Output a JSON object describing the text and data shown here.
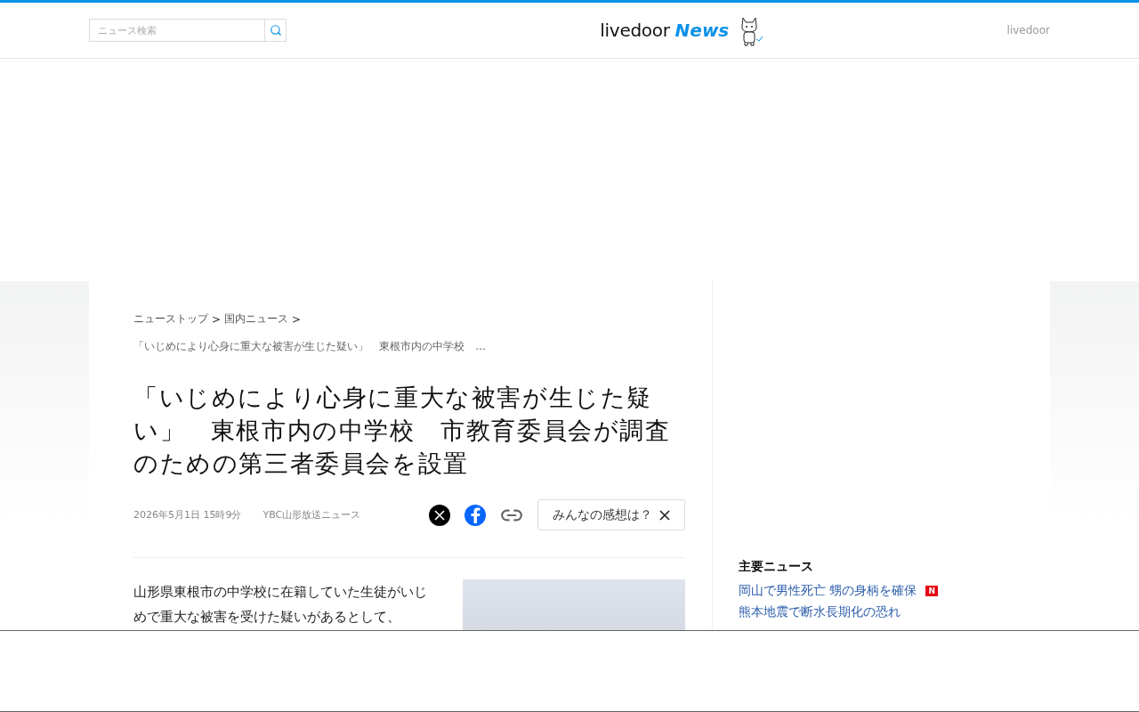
{
  "header": {
    "search": {
      "placeholder": "ニュース検索"
    },
    "logo": {
      "brand": "livedoor",
      "product": "News"
    },
    "right_link": "livedoor"
  },
  "breadcrumb": {
    "items": [
      "ニューストップ",
      "国内ニュース"
    ],
    "separator": ">",
    "current": "「いじめにより心身に重大な被害が生じた疑い」　東根市内の中学校　…"
  },
  "article": {
    "title": "「いじめにより心身に重大な被害が生じた疑い」　東根市内の中学校　市教育委員会が調査のための第三者委員会を設置",
    "date": "2026年5月1日 15時9分",
    "source": "YBC山形放送ニュース",
    "reaction_button": "みんなの感想は？",
    "body": "山形県東根市の中学校に在籍していた生徒がいじめで重大な被害を受けた疑いがあるとして、"
  },
  "sidebar": {
    "heading": "主要ニュース",
    "items": [
      {
        "title": "岡山で男性死亡 甥の身柄を確保",
        "new": true,
        "badge": "N"
      },
      {
        "title": "熊本地震で断水長期化の恐れ",
        "new": false
      }
    ]
  }
}
